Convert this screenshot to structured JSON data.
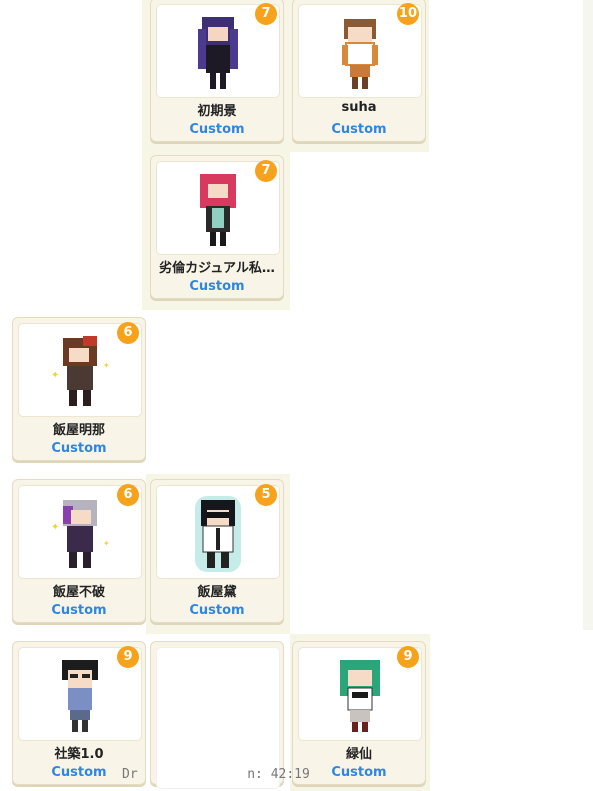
{
  "cards": [
    {
      "name": "初期景",
      "type": "Custom",
      "count": "7",
      "icon": "character-purple-hair"
    },
    {
      "name": "suha",
      "type": "Custom",
      "count": "10",
      "icon": "character-brown-hair"
    },
    {
      "name": "劣倫カジュアル私…",
      "type": "Custom",
      "count": "7",
      "icon": "character-pink-hair"
    },
    {
      "name": "飯屋明那",
      "type": "Custom",
      "count": "6",
      "icon": "character-brown-red-hair"
    },
    {
      "name": "飯屋不破",
      "type": "Custom",
      "count": "6",
      "icon": "character-silver-purple-hair"
    },
    {
      "name": "飯屋黛",
      "type": "Custom",
      "count": "5",
      "icon": "character-sunglasses"
    },
    {
      "name": "社築1.0",
      "type": "Custom",
      "count": "9",
      "icon": "character-black-hair"
    },
    {
      "name": "",
      "type": "",
      "count": "",
      "icon": ""
    },
    {
      "name": "緑仙",
      "type": "Custom",
      "count": "9",
      "icon": "character-green-hair"
    }
  ],
  "status_text": "Dr              n: 42:19"
}
